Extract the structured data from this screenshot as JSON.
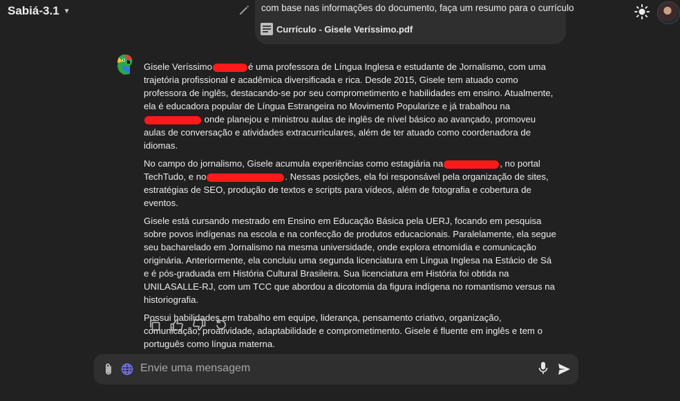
{
  "header": {
    "model_name": "Sabiá-3.1",
    "model_icon": "chevron-down-icon",
    "theme_icon": "sun-icon",
    "avatar": "user-avatar"
  },
  "user_message": {
    "text": "com base nas informações do documento, faça um resumo para o currículo",
    "attachment_name": "Currículo - Gisele Veríssimo.pdf",
    "attachment_icon": "document-icon",
    "edit_icon": "pencil-icon"
  },
  "assistant": {
    "avatar_icon": "parrot-logo-icon",
    "p1_a": "Gisele Veríssimo",
    "p1_b": "é uma professora de Língua Inglesa e estudante de Jornalismo, com uma trajetória profissional e acadêmica diversificada e rica. Desde 2015, Gisele tem atuado como professora de inglês, destacando-se por seu comprometimento e habilidades em ensino. Atualmente, ela é educadora popular de Língua Estrangeira no Movimento Popularize e já trabalhou na",
    "p1_c": "onde planejou e ministrou aulas de inglês de nível básico ao avançado, promoveu aulas de conversação e atividades extracurriculares, além de ter atuado como coordenadora de idiomas.",
    "p2_a": "No campo do jornalismo, Gisele acumula experiências como estagiária na",
    "p2_b": ", no portal TechTudo, e no",
    "p2_c": ". Nessas posições, ela foi responsável pela organização de sites, estratégias de SEO, produção de textos e scripts para vídeos, além de fotografia e cobertura de eventos.",
    "p3": "Gisele está cursando mestrado em Ensino em Educação Básica pela UERJ, focando em pesquisa sobre povos indígenas na escola e na confecção de produtos educacionais. Paralelamente, ela segue seu bacharelado em Jornalismo na mesma universidade, onde explora etnomídia e comunicação originária. Anteriormente, ela concluiu uma segunda licenciatura em Língua Inglesa na Estácio de Sá e é pós-graduada em História Cultural Brasileira. Sua licenciatura em História foi obtida na UNILASALLE-RJ, com um TCC que abordou a dicotomia da figura indígena no romantismo versus na historiografia.",
    "p4": "Possui habilidades em trabalho em equipe, liderança, pensamento criativo, organização, comunicação, proatividade, adaptabilidade e comprometimento. Gisele é fluente em inglês e tem o português como língua materna.",
    "actions": [
      "copy-icon",
      "thumbs-up-icon",
      "thumbs-down-icon",
      "regenerate-icon"
    ]
  },
  "composer": {
    "placeholder": "Envie uma mensagem",
    "attach_icon": "paperclip-icon",
    "web_icon": "globe-icon",
    "mic_icon": "microphone-icon",
    "send_icon": "send-icon"
  },
  "colors": {
    "background": "#212121",
    "bubble": "#2f2f2f",
    "text": "#ececec",
    "redaction": "#ff1a1a",
    "placeholder": "#a8a8a8"
  }
}
